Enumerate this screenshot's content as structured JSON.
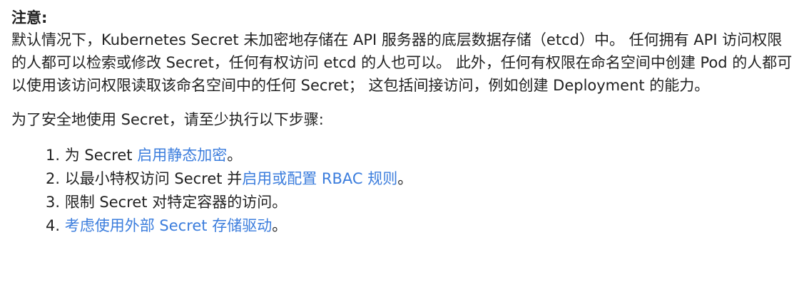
{
  "note": {
    "title": "注意:",
    "paragraph1": "默认情况下，Kubernetes Secret 未加密地存储在 API 服务器的底层数据存储（etcd）中。 任何拥有 API 访问权限的人都可以检索或修改 Secret，任何有权访问 etcd 的人也可以。 此外，任何有权限在命名空间中创建 Pod 的人都可以使用该访问权限读取该命名空间中的任何 Secret； 这包括间接访问，例如创建 Deployment 的能力。",
    "paragraph2": "为了安全地使用 Secret，请至少执行以下步骤:",
    "steps": [
      {
        "number": "1.",
        "prefix": "为 Secret ",
        "link": "启用静态加密",
        "suffix": "。"
      },
      {
        "number": "2.",
        "prefix": "以最小特权访问 Secret 并",
        "link": "启用或配置 RBAC 规则",
        "suffix": "。"
      },
      {
        "number": "3.",
        "prefix": "限制 Secret 对特定容器的访问。",
        "link": "",
        "suffix": ""
      },
      {
        "number": "4.",
        "prefix": "",
        "link": "考虑使用外部 Secret 存储驱动",
        "suffix": "。"
      }
    ]
  },
  "colors": {
    "text": "#222222",
    "link": "#3b7ddd",
    "background": "#ffffff"
  }
}
